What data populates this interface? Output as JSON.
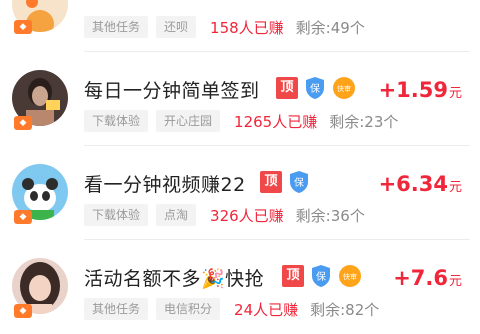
{
  "tasks": [
    {
      "title": "",
      "tag1": "其他任务",
      "tag2": "还呗",
      "earned": "158人已赚",
      "remaining": "剩余:49个",
      "price": "",
      "unit": "",
      "badges": {
        "top": "",
        "bao": false,
        "kuai": false
      },
      "avatar": {
        "bg": "#f6e3c9",
        "fg": "#f4a340"
      }
    },
    {
      "title": "每日一分钟简单签到",
      "tag1": "下载体验",
      "tag2": "开心庄园",
      "earned": "1265人已赚",
      "remaining": "剩余:23个",
      "price": "+1.59",
      "unit": "元",
      "badges": {
        "top": "顶",
        "bao": true,
        "kuai": true,
        "bao_text": "保",
        "kuai_text": "快审"
      },
      "avatar": {
        "bg": "#4a3a36",
        "fg": "#c9a58f"
      }
    },
    {
      "title": "看一分钟视频赚22",
      "tag1": "下载体验",
      "tag2": "点淘",
      "earned": "326人已赚",
      "remaining": "剩余:36个",
      "price": "+6.34",
      "unit": "元",
      "badges": {
        "top": "顶",
        "bao": true,
        "kuai": false,
        "bao_text": "保"
      },
      "avatar": {
        "bg": "#7fc9f0",
        "fg": "#2d2d2d"
      }
    },
    {
      "title": "活动名额不多🎉快抢",
      "tag1": "其他任务",
      "tag2": "电信积分",
      "earned": "24人已赚",
      "remaining": "剩余:82个",
      "price": "+7.6",
      "unit": "元",
      "badges": {
        "top": "顶",
        "bao": true,
        "kuai": true,
        "bao_text": "保",
        "kuai_text": "快审"
      },
      "avatar": {
        "bg": "#e9d2c9",
        "fg": "#3b2a26"
      }
    }
  ],
  "colors": {
    "accent_red": "#f0263a",
    "top_badge": "#f04848",
    "bao_badge": "#4a9cf0",
    "kuai_badge": "#ffa31a"
  }
}
